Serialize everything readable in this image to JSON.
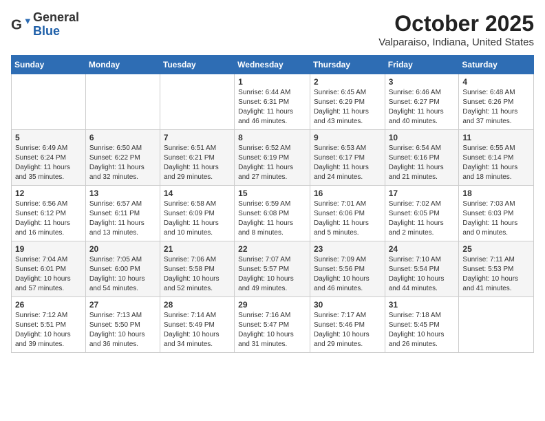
{
  "header": {
    "logo_general": "General",
    "logo_blue": "Blue",
    "title": "October 2025",
    "subtitle": "Valparaiso, Indiana, United States"
  },
  "weekdays": [
    "Sunday",
    "Monday",
    "Tuesday",
    "Wednesday",
    "Thursday",
    "Friday",
    "Saturday"
  ],
  "weeks": [
    [
      {
        "day": "",
        "info": ""
      },
      {
        "day": "",
        "info": ""
      },
      {
        "day": "",
        "info": ""
      },
      {
        "day": "1",
        "info": "Sunrise: 6:44 AM\nSunset: 6:31 PM\nDaylight: 11 hours\nand 46 minutes."
      },
      {
        "day": "2",
        "info": "Sunrise: 6:45 AM\nSunset: 6:29 PM\nDaylight: 11 hours\nand 43 minutes."
      },
      {
        "day": "3",
        "info": "Sunrise: 6:46 AM\nSunset: 6:27 PM\nDaylight: 11 hours\nand 40 minutes."
      },
      {
        "day": "4",
        "info": "Sunrise: 6:48 AM\nSunset: 6:26 PM\nDaylight: 11 hours\nand 37 minutes."
      }
    ],
    [
      {
        "day": "5",
        "info": "Sunrise: 6:49 AM\nSunset: 6:24 PM\nDaylight: 11 hours\nand 35 minutes."
      },
      {
        "day": "6",
        "info": "Sunrise: 6:50 AM\nSunset: 6:22 PM\nDaylight: 11 hours\nand 32 minutes."
      },
      {
        "day": "7",
        "info": "Sunrise: 6:51 AM\nSunset: 6:21 PM\nDaylight: 11 hours\nand 29 minutes."
      },
      {
        "day": "8",
        "info": "Sunrise: 6:52 AM\nSunset: 6:19 PM\nDaylight: 11 hours\nand 27 minutes."
      },
      {
        "day": "9",
        "info": "Sunrise: 6:53 AM\nSunset: 6:17 PM\nDaylight: 11 hours\nand 24 minutes."
      },
      {
        "day": "10",
        "info": "Sunrise: 6:54 AM\nSunset: 6:16 PM\nDaylight: 11 hours\nand 21 minutes."
      },
      {
        "day": "11",
        "info": "Sunrise: 6:55 AM\nSunset: 6:14 PM\nDaylight: 11 hours\nand 18 minutes."
      }
    ],
    [
      {
        "day": "12",
        "info": "Sunrise: 6:56 AM\nSunset: 6:12 PM\nDaylight: 11 hours\nand 16 minutes."
      },
      {
        "day": "13",
        "info": "Sunrise: 6:57 AM\nSunset: 6:11 PM\nDaylight: 11 hours\nand 13 minutes."
      },
      {
        "day": "14",
        "info": "Sunrise: 6:58 AM\nSunset: 6:09 PM\nDaylight: 11 hours\nand 10 minutes."
      },
      {
        "day": "15",
        "info": "Sunrise: 6:59 AM\nSunset: 6:08 PM\nDaylight: 11 hours\nand 8 minutes."
      },
      {
        "day": "16",
        "info": "Sunrise: 7:01 AM\nSunset: 6:06 PM\nDaylight: 11 hours\nand 5 minutes."
      },
      {
        "day": "17",
        "info": "Sunrise: 7:02 AM\nSunset: 6:05 PM\nDaylight: 11 hours\nand 2 minutes."
      },
      {
        "day": "18",
        "info": "Sunrise: 7:03 AM\nSunset: 6:03 PM\nDaylight: 11 hours\nand 0 minutes."
      }
    ],
    [
      {
        "day": "19",
        "info": "Sunrise: 7:04 AM\nSunset: 6:01 PM\nDaylight: 10 hours\nand 57 minutes."
      },
      {
        "day": "20",
        "info": "Sunrise: 7:05 AM\nSunset: 6:00 PM\nDaylight: 10 hours\nand 54 minutes."
      },
      {
        "day": "21",
        "info": "Sunrise: 7:06 AM\nSunset: 5:58 PM\nDaylight: 10 hours\nand 52 minutes."
      },
      {
        "day": "22",
        "info": "Sunrise: 7:07 AM\nSunset: 5:57 PM\nDaylight: 10 hours\nand 49 minutes."
      },
      {
        "day": "23",
        "info": "Sunrise: 7:09 AM\nSunset: 5:56 PM\nDaylight: 10 hours\nand 46 minutes."
      },
      {
        "day": "24",
        "info": "Sunrise: 7:10 AM\nSunset: 5:54 PM\nDaylight: 10 hours\nand 44 minutes."
      },
      {
        "day": "25",
        "info": "Sunrise: 7:11 AM\nSunset: 5:53 PM\nDaylight: 10 hours\nand 41 minutes."
      }
    ],
    [
      {
        "day": "26",
        "info": "Sunrise: 7:12 AM\nSunset: 5:51 PM\nDaylight: 10 hours\nand 39 minutes."
      },
      {
        "day": "27",
        "info": "Sunrise: 7:13 AM\nSunset: 5:50 PM\nDaylight: 10 hours\nand 36 minutes."
      },
      {
        "day": "28",
        "info": "Sunrise: 7:14 AM\nSunset: 5:49 PM\nDaylight: 10 hours\nand 34 minutes."
      },
      {
        "day": "29",
        "info": "Sunrise: 7:16 AM\nSunset: 5:47 PM\nDaylight: 10 hours\nand 31 minutes."
      },
      {
        "day": "30",
        "info": "Sunrise: 7:17 AM\nSunset: 5:46 PM\nDaylight: 10 hours\nand 29 minutes."
      },
      {
        "day": "31",
        "info": "Sunrise: 7:18 AM\nSunset: 5:45 PM\nDaylight: 10 hours\nand 26 minutes."
      },
      {
        "day": "",
        "info": ""
      }
    ]
  ]
}
